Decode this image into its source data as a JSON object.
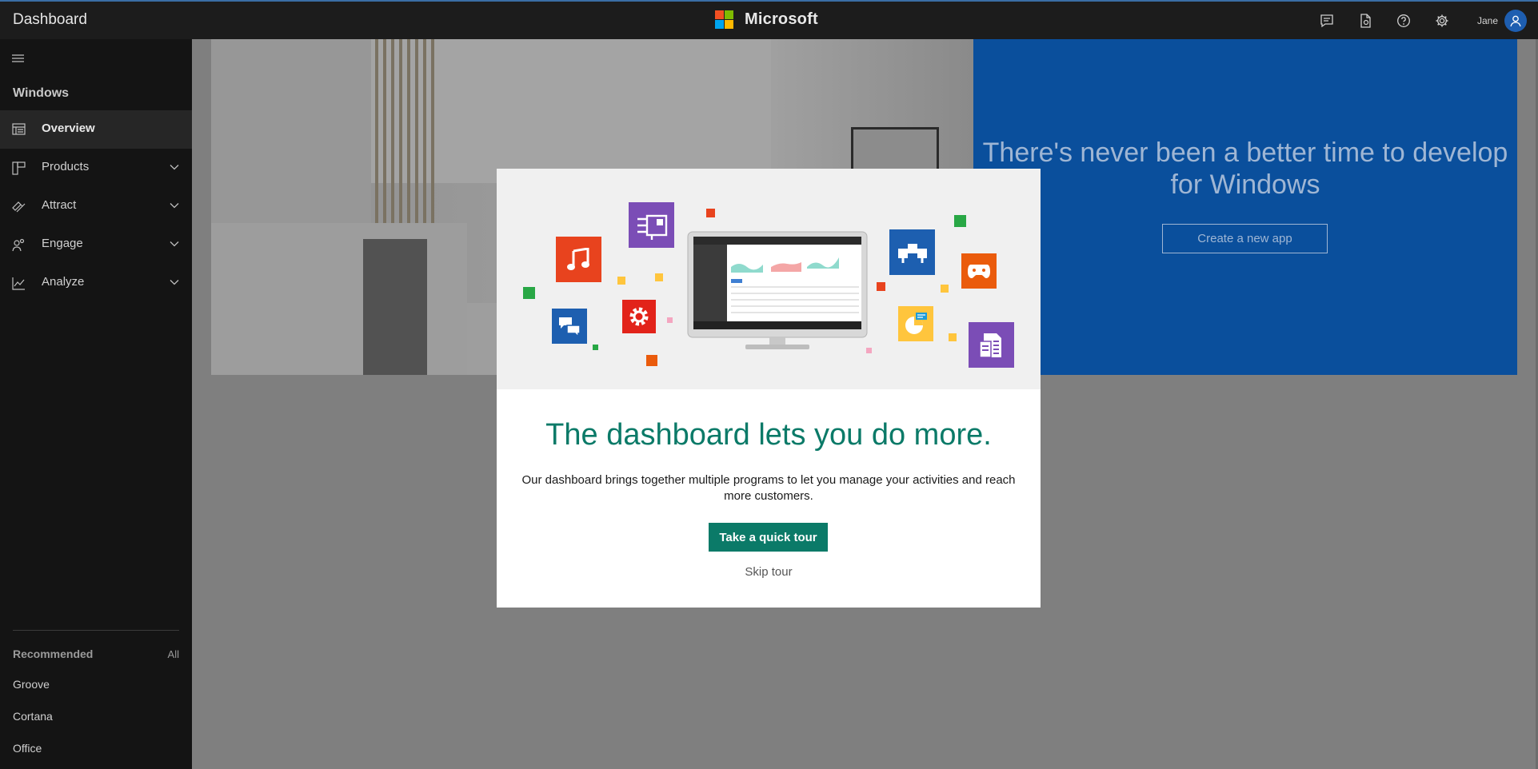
{
  "header": {
    "app_title": "Dashboard",
    "brand_name": "Microsoft",
    "user_name": "Jane",
    "icons": [
      "feedback-icon",
      "document-icon",
      "help-icon",
      "settings-icon",
      "user-icon"
    ]
  },
  "colors": {
    "accent": "#0b7a68",
    "hero_blue": "#0a4f9c",
    "logo_red": "#f25022",
    "logo_green": "#7fba00",
    "logo_blue": "#00a4ef",
    "logo_yellow": "#ffb900"
  },
  "sidebar": {
    "section": "Windows",
    "items": [
      {
        "label": "Overview",
        "icon": "overview-icon",
        "active": true
      },
      {
        "label": "Products",
        "icon": "products-icon",
        "expandable": true
      },
      {
        "label": "Attract",
        "icon": "attract-icon",
        "expandable": true
      },
      {
        "label": "Engage",
        "icon": "engage-icon",
        "expandable": true
      },
      {
        "label": "Analyze",
        "icon": "analyze-icon",
        "expandable": true
      }
    ],
    "recommended": {
      "label": "Recommended",
      "all_label": "All",
      "items": [
        "Groove",
        "Cortana",
        "Office"
      ]
    }
  },
  "hero": {
    "headline": "There's never been a better time to develop for Windows",
    "button": "Create a new app"
  },
  "modal": {
    "title": "The dashboard lets you do more.",
    "body": "Our dashboard brings together multiple programs to let you manage your activities and reach more customers.",
    "primary_button": "Take a quick tour",
    "secondary_link": "Skip tour"
  }
}
